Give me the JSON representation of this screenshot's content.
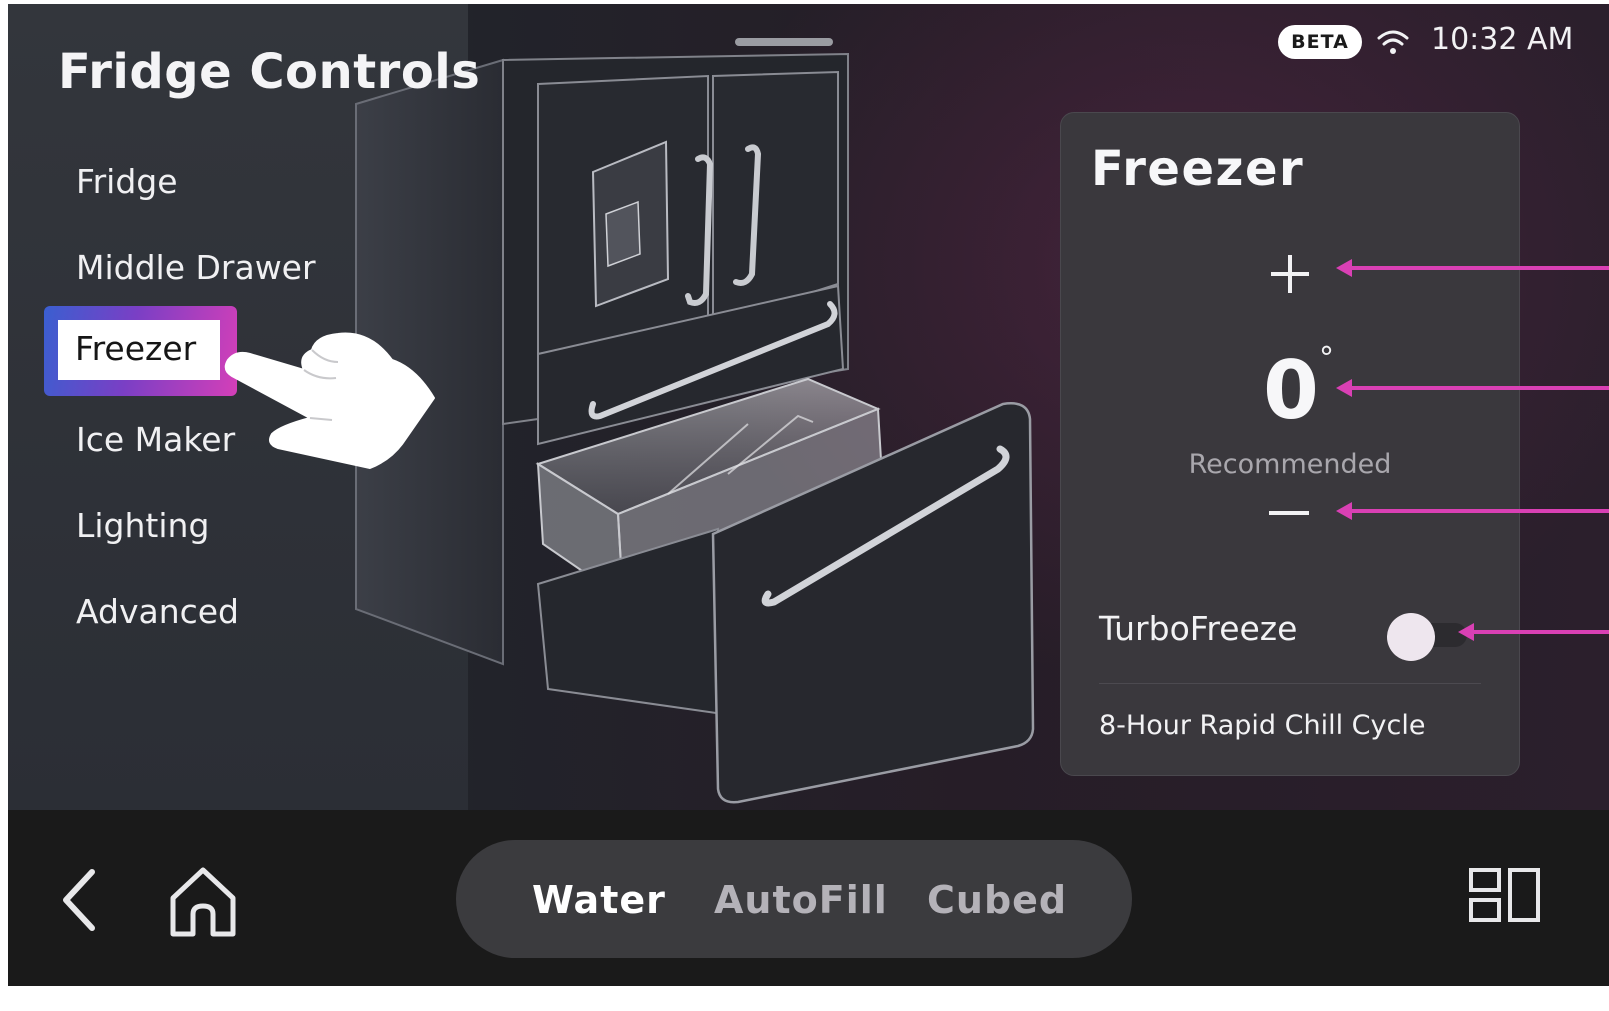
{
  "app": {
    "title": "Fridge Controls"
  },
  "status_bar": {
    "badge": "BETA",
    "wifi_icon": "wifi-icon",
    "time": "10:32 AM"
  },
  "sidebar": {
    "items": [
      {
        "label": "Fridge"
      },
      {
        "label": "Middle Drawer"
      },
      {
        "label": "Freezer",
        "selected": true
      },
      {
        "label": "Ice Maker"
      },
      {
        "label": "Lighting"
      },
      {
        "label": "Advanced"
      }
    ]
  },
  "freezer_panel": {
    "title": "Freezer",
    "increase_icon": "plus-icon",
    "temperature": "0",
    "degree_symbol": "°",
    "temperature_caption": "Recommended",
    "decrease_icon": "minus-icon",
    "turbo": {
      "label": "TurboFreeze",
      "enabled": false,
      "description": "8-Hour Rapid Chill Cycle"
    }
  },
  "bottom_bar": {
    "back_icon": "chevron-left-icon",
    "home_icon": "home-icon",
    "quick_actions": [
      {
        "label": "Water",
        "active": true
      },
      {
        "label": "AutoFill",
        "active": false
      },
      {
        "label": "Cubed",
        "active": false
      }
    ],
    "apps_icon": "grid-icon"
  },
  "colors": {
    "accent_callout": "#d940b4",
    "selected_gradient_start": "#3a5fd0",
    "selected_gradient_end": "#d43fb8",
    "active_pill_text": "#ffffff",
    "inactive_pill_text": "#b4b2b8"
  }
}
